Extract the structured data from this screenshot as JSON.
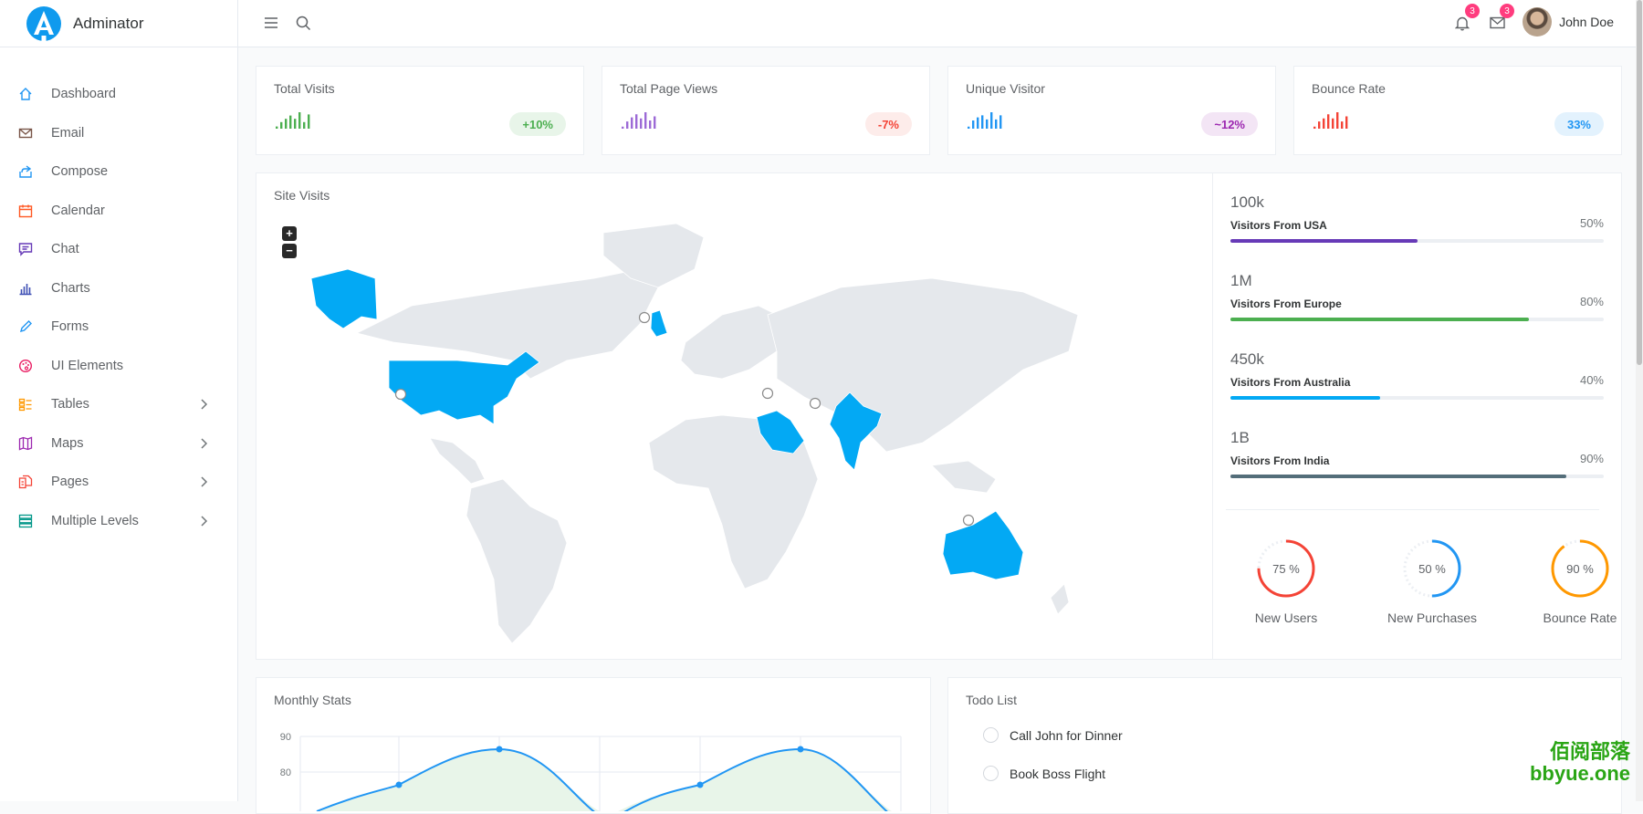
{
  "brand": {
    "name": "Adminator"
  },
  "sidebar": {
    "items": [
      {
        "label": "Dashboard",
        "icon": "home-icon",
        "color": "#2196f3",
        "has_children": false
      },
      {
        "label": "Email",
        "icon": "mail-icon",
        "color": "#795548",
        "has_children": false
      },
      {
        "label": "Compose",
        "icon": "share-icon",
        "color": "#2196f3",
        "has_children": false
      },
      {
        "label": "Calendar",
        "icon": "calendar-icon",
        "color": "#ff5722",
        "has_children": false
      },
      {
        "label": "Chat",
        "icon": "chat-icon",
        "color": "#673ab7",
        "has_children": false
      },
      {
        "label": "Charts",
        "icon": "bar-chart-icon",
        "color": "#3f51b5",
        "has_children": false
      },
      {
        "label": "Forms",
        "icon": "pencil-icon",
        "color": "#2196f3",
        "has_children": false
      },
      {
        "label": "UI Elements",
        "icon": "palette-icon",
        "color": "#e91e63",
        "has_children": false
      },
      {
        "label": "Tables",
        "icon": "layout-list-icon",
        "color": "#ff9800",
        "has_children": true
      },
      {
        "label": "Maps",
        "icon": "map-icon",
        "color": "#9c27b0",
        "has_children": true
      },
      {
        "label": "Pages",
        "icon": "files-icon",
        "color": "#f44336",
        "has_children": true
      },
      {
        "label": "Multiple Levels",
        "icon": "stack-icon",
        "color": "#009688",
        "has_children": true
      }
    ]
  },
  "header": {
    "notifications_count": "3",
    "messages_count": "3",
    "user_name": "John Doe"
  },
  "stats": [
    {
      "title": "Total Visits",
      "badge": "+10%",
      "color": "#4caf50",
      "bg": "#e8f5e9",
      "bars": [
        2,
        6,
        9,
        12,
        9,
        15,
        6,
        13
      ]
    },
    {
      "title": "Total Page Views",
      "badge": "-7%",
      "color": "#f44336",
      "bg": "#fdecea",
      "bar_color": "#9c6ad6",
      "bars": [
        2,
        7,
        11,
        14,
        10,
        16,
        8,
        12
      ]
    },
    {
      "title": "Unique Visitor",
      "badge": "~12%",
      "color": "#9c27b0",
      "bg": "#f3e5f5",
      "bar_color": "#2196f3",
      "bars": [
        2,
        8,
        11,
        13,
        9,
        16,
        9,
        13
      ]
    },
    {
      "title": "Bounce Rate",
      "badge": "33%",
      "color": "#2196f3",
      "bg": "#e3f2fd",
      "bar_color": "#f44336",
      "bars": [
        2,
        7,
        10,
        14,
        10,
        16,
        7,
        12
      ]
    }
  ],
  "site_visits": {
    "title": "Site Visits",
    "zoom_in": "+",
    "zoom_out": "−",
    "highlight_color": "#03a9f4",
    "land_color": "#e5e8ec"
  },
  "visitors": [
    {
      "value": "100k",
      "label": "Visitors From USA",
      "pct_text": "50%",
      "pct": 50,
      "color": "#673ab7"
    },
    {
      "value": "1M",
      "label": "Visitors From Europe",
      "pct_text": "80%",
      "pct": 80,
      "color": "#4caf50"
    },
    {
      "value": "450k",
      "label": "Visitors From Australia",
      "pct_text": "40%",
      "pct": 40,
      "color": "#03a9f4"
    },
    {
      "value": "1B",
      "label": "Visitors From India",
      "pct_text": "90%",
      "pct": 90,
      "color": "#546e7a"
    }
  ],
  "gauges": [
    {
      "value_text": "75 %",
      "label": "New Users",
      "pct": 75,
      "color": "#f44336"
    },
    {
      "value_text": "50 %",
      "label": "New Purchases",
      "pct": 50,
      "color": "#2196f3"
    },
    {
      "value_text": "90 %",
      "label": "Bounce Rate",
      "pct": 90,
      "color": "#ff9800"
    }
  ],
  "monthly_stats": {
    "title": "Monthly Stats",
    "chart_data": {
      "type": "line",
      "y_tick_labels": [
        "90",
        "80"
      ],
      "line_color": "#2196f3",
      "fill_color": "#e8f5e9"
    }
  },
  "todo": {
    "title": "Todo List",
    "items": [
      "Call John for Dinner",
      "Book Boss Flight"
    ]
  },
  "watermark": {
    "line1": "佰阅部落",
    "line2": "bbyue.one"
  }
}
